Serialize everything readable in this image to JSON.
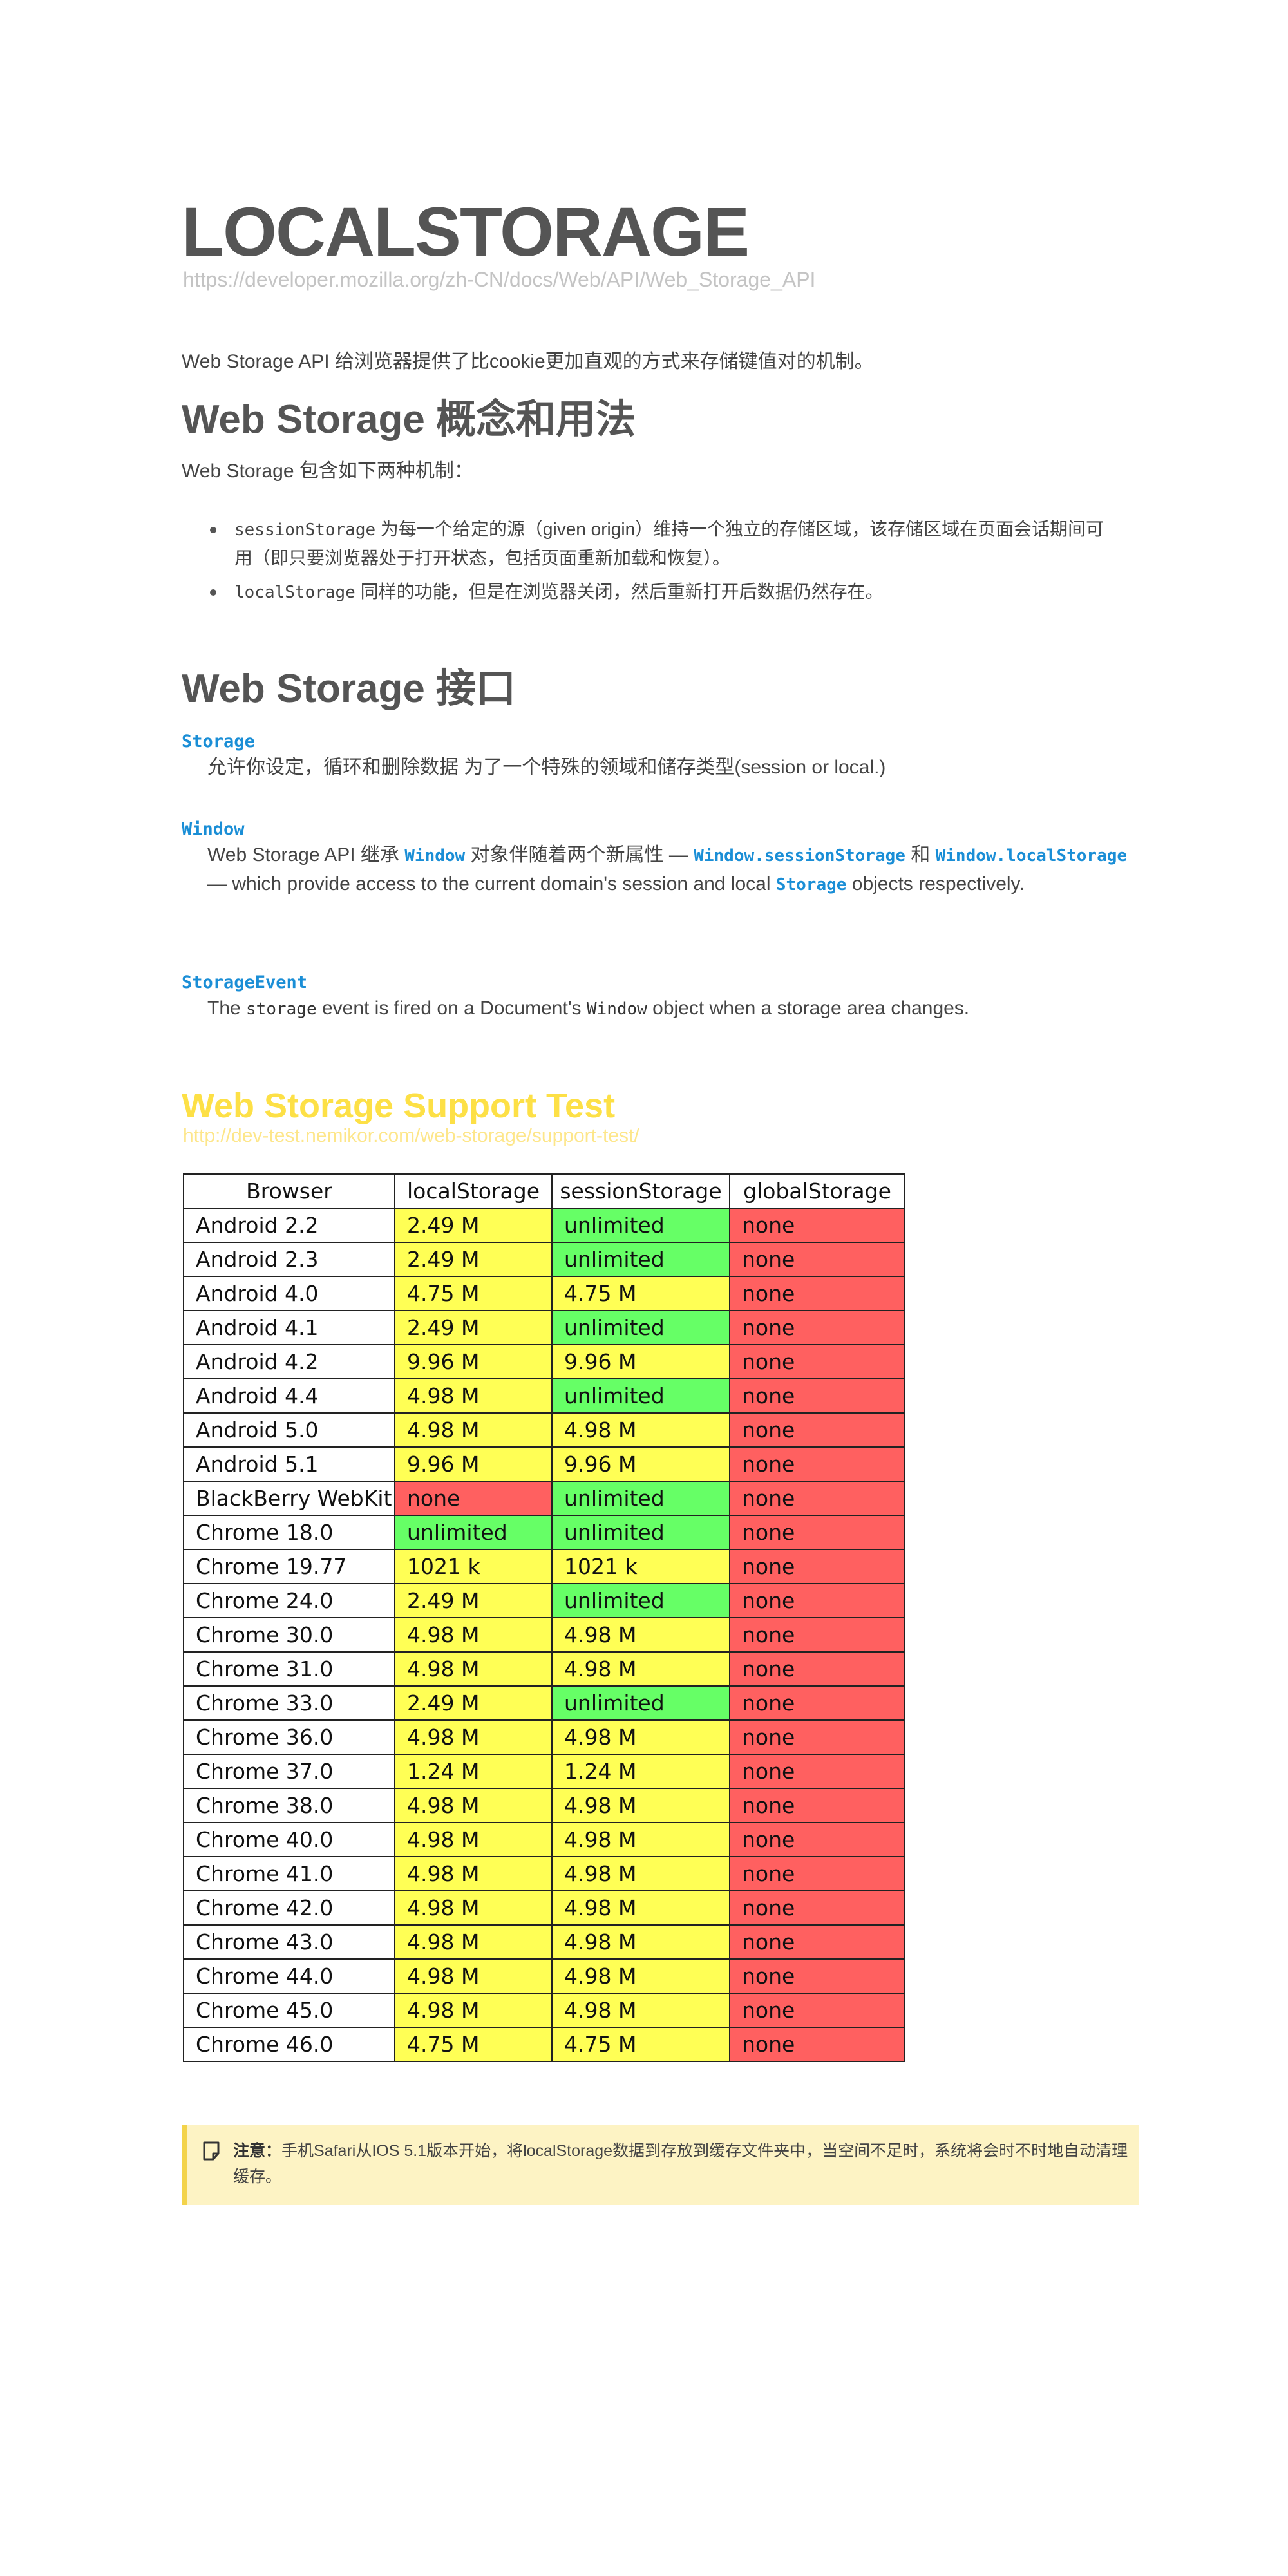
{
  "header": {
    "title": "LOCALSTORAGE",
    "url": "https://developer.mozilla.org/zh-CN/docs/Web/API/Web_Storage_API"
  },
  "intro": "Web Storage API 给浏览器提供了比cookie更加直观的方式来存储键值对的机制。",
  "concepts": {
    "heading": "Web Storage 概念和用法",
    "lead": "Web Storage 包含如下两种机制：",
    "items": [
      {
        "code": "sessionStorage",
        "text": " 为每一个给定的源（given origin）维持一个独立的存储区域，该存储区域在页面会话期间可用（即只要浏览器处于打开状态，包括页面重新加载和恢复）。"
      },
      {
        "code": "localStorage",
        "text": " 同样的功能，但是在浏览器关闭，然后重新打开后数据仍然存在。"
      }
    ]
  },
  "interfaces": {
    "heading": "Web Storage 接口",
    "storage_term": "Storage",
    "storage_desc": "允许你设定，循环和删除数据 为了一个特殊的领域和储存类型(session or local.)",
    "window_term": "Window",
    "window_desc_1": "Web Storage API 继承 ",
    "window_code_1": "Window",
    "window_desc_2": " 对象伴随着两个新属性 — ",
    "window_code_2": "Window.sessionStorage",
    "window_desc_3": " 和 ",
    "window_code_3": "Window.localStorage",
    "window_desc_4": " — which provide access to the current domain's session and local ",
    "window_code_4": "Storage",
    "window_desc_5": " objects respectively.",
    "event_term": "StorageEvent",
    "event_desc_1": "The ",
    "event_code_1": "storage",
    "event_desc_2": " event is fired on a Document's ",
    "event_code_2": "Window",
    "event_desc_3": " object when a storage area changes."
  },
  "support_test": {
    "title": "Web Storage Support Test",
    "url": "http://dev-test.nemikor.com/web-storage/support-test/",
    "columns": [
      "Browser",
      "localStorage",
      "sessionStorage",
      "globalStorage"
    ],
    "colors": {
      "green": "#66ff66",
      "yellow": "#ffff55",
      "red": "#ff6060"
    },
    "rows": [
      {
        "browser": "Android 2.2",
        "local": "2.49 M",
        "session": "unlimited",
        "global": "none",
        "lc": "yellow",
        "sc": "green",
        "gc": "red"
      },
      {
        "browser": "Android 2.3",
        "local": "2.49 M",
        "session": "unlimited",
        "global": "none",
        "lc": "yellow",
        "sc": "green",
        "gc": "red"
      },
      {
        "browser": "Android 4.0",
        "local": "4.75 M",
        "session": "4.75 M",
        "global": "none",
        "lc": "yellow",
        "sc": "yellow",
        "gc": "red"
      },
      {
        "browser": "Android 4.1",
        "local": "2.49 M",
        "session": "unlimited",
        "global": "none",
        "lc": "yellow",
        "sc": "green",
        "gc": "red"
      },
      {
        "browser": "Android 4.2",
        "local": "9.96 M",
        "session": "9.96 M",
        "global": "none",
        "lc": "yellow",
        "sc": "yellow",
        "gc": "red"
      },
      {
        "browser": "Android 4.4",
        "local": "4.98 M",
        "session": "unlimited",
        "global": "none",
        "lc": "yellow",
        "sc": "green",
        "gc": "red"
      },
      {
        "browser": "Android 5.0",
        "local": "4.98 M",
        "session": "4.98 M",
        "global": "none",
        "lc": "yellow",
        "sc": "yellow",
        "gc": "red"
      },
      {
        "browser": "Android 5.1",
        "local": "9.96 M",
        "session": "9.96 M",
        "global": "none",
        "lc": "yellow",
        "sc": "yellow",
        "gc": "red"
      },
      {
        "browser": "BlackBerry WebKit",
        "local": "none",
        "session": "unlimited",
        "global": "none",
        "lc": "red",
        "sc": "green",
        "gc": "red"
      },
      {
        "browser": "Chrome 18.0",
        "local": "unlimited",
        "session": "unlimited",
        "global": "none",
        "lc": "green",
        "sc": "green",
        "gc": "red"
      },
      {
        "browser": "Chrome 19.77",
        "local": "1021 k",
        "session": "1021 k",
        "global": "none",
        "lc": "yellow",
        "sc": "yellow",
        "gc": "red"
      },
      {
        "browser": "Chrome 24.0",
        "local": "2.49 M",
        "session": "unlimited",
        "global": "none",
        "lc": "yellow",
        "sc": "green",
        "gc": "red"
      },
      {
        "browser": "Chrome 30.0",
        "local": "4.98 M",
        "session": "4.98 M",
        "global": "none",
        "lc": "yellow",
        "sc": "yellow",
        "gc": "red"
      },
      {
        "browser": "Chrome 31.0",
        "local": "4.98 M",
        "session": "4.98 M",
        "global": "none",
        "lc": "yellow",
        "sc": "yellow",
        "gc": "red"
      },
      {
        "browser": "Chrome 33.0",
        "local": "2.49 M",
        "session": "unlimited",
        "global": "none",
        "lc": "yellow",
        "sc": "green",
        "gc": "red"
      },
      {
        "browser": "Chrome 36.0",
        "local": "4.98 M",
        "session": "4.98 M",
        "global": "none",
        "lc": "yellow",
        "sc": "yellow",
        "gc": "red"
      },
      {
        "browser": "Chrome 37.0",
        "local": "1.24 M",
        "session": "1.24 M",
        "global": "none",
        "lc": "yellow",
        "sc": "yellow",
        "gc": "red"
      },
      {
        "browser": "Chrome 38.0",
        "local": "4.98 M",
        "session": "4.98 M",
        "global": "none",
        "lc": "yellow",
        "sc": "yellow",
        "gc": "red"
      },
      {
        "browser": "Chrome 40.0",
        "local": "4.98 M",
        "session": "4.98 M",
        "global": "none",
        "lc": "yellow",
        "sc": "yellow",
        "gc": "red"
      },
      {
        "browser": "Chrome 41.0",
        "local": "4.98 M",
        "session": "4.98 M",
        "global": "none",
        "lc": "yellow",
        "sc": "yellow",
        "gc": "red"
      },
      {
        "browser": "Chrome 42.0",
        "local": "4.98 M",
        "session": "4.98 M",
        "global": "none",
        "lc": "yellow",
        "sc": "yellow",
        "gc": "red"
      },
      {
        "browser": "Chrome 43.0",
        "local": "4.98 M",
        "session": "4.98 M",
        "global": "none",
        "lc": "yellow",
        "sc": "yellow",
        "gc": "red"
      },
      {
        "browser": "Chrome 44.0",
        "local": "4.98 M",
        "session": "4.98 M",
        "global": "none",
        "lc": "yellow",
        "sc": "yellow",
        "gc": "red"
      },
      {
        "browser": "Chrome 45.0",
        "local": "4.98 M",
        "session": "4.98 M",
        "global": "none",
        "lc": "yellow",
        "sc": "yellow",
        "gc": "red"
      },
      {
        "browser": "Chrome 46.0",
        "local": "4.75 M",
        "session": "4.75 M",
        "global": "none",
        "lc": "yellow",
        "sc": "yellow",
        "gc": "red"
      }
    ]
  },
  "note": {
    "icon": "note-icon",
    "label": "注意：",
    "text": "手机Safari从IOS 5.1版本开始，将localStorage数据到存放到缓存文件夹中，当空间不足时，系统将会时不时地自动清理缓存。"
  }
}
